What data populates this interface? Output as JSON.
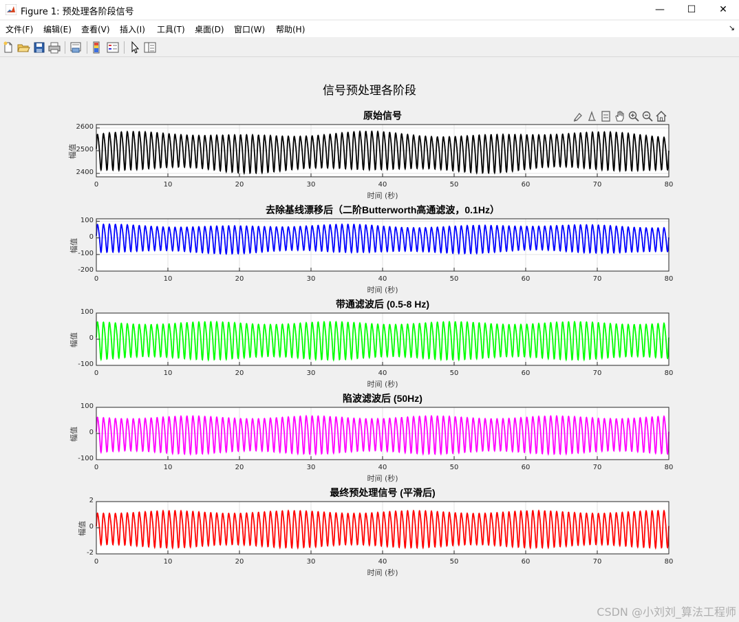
{
  "window": {
    "title": "Figure 1: 预处理各阶段信号",
    "minimize_glyph": "—",
    "maximize_glyph": "☐",
    "close_glyph": "✕"
  },
  "menu": [
    "文件(F)",
    "编辑(E)",
    "查看(V)",
    "插入(I)",
    "工具(T)",
    "桌面(D)",
    "窗口(W)",
    "帮助(H)"
  ],
  "menu_arrow": "↘",
  "toolbar_icons": [
    "new-figure-icon",
    "open-file-icon",
    "save-icon",
    "print-icon",
    "print-preview-icon",
    "colorbar-icon",
    "legend-icon",
    "cursor-icon",
    "property-editor-icon"
  ],
  "axes_toolbar_icons": [
    "brush-icon",
    "data-tips-icon",
    "restore-view-icon",
    "pan-icon",
    "zoom-in-icon",
    "zoom-out-icon",
    "home-icon"
  ],
  "figure_title": "信号预处理各阶段",
  "chart_data": [
    {
      "type": "line",
      "title": "原始信号",
      "xlabel": "时间 (秒)",
      "ylabel": "幅值",
      "xlim": [
        0,
        80
      ],
      "ylim": [
        2385,
        2615
      ],
      "xticks": [
        "0",
        "10",
        "20",
        "30",
        "40",
        "50",
        "60",
        "70",
        "80"
      ],
      "yticks": [
        "2400",
        "2500",
        "2600"
      ],
      "ytick_values": [
        2400,
        2500,
        2600
      ],
      "color": "#000000",
      "signal": {
        "baseline": 2500,
        "amplitude": 95,
        "beats": 96,
        "drift": 8
      },
      "grid": true
    },
    {
      "type": "line",
      "title": "去除基线漂移后（二阶Butterworth高通滤波，0.1Hz）",
      "xlabel": "时间 (秒)",
      "ylabel": "幅值",
      "xlim": [
        0,
        80
      ],
      "ylim": [
        -200,
        115
      ],
      "xticks": [
        "0",
        "10",
        "20",
        "30",
        "40",
        "50",
        "60",
        "70",
        "80"
      ],
      "yticks": [
        "100",
        "0",
        "-100",
        "-200"
      ],
      "ytick_values": [
        100,
        0,
        -100,
        -200
      ],
      "color": "#0000ff",
      "signal": {
        "baseline": 0,
        "amplitude": 95,
        "beats": 96,
        "drift": 5
      },
      "grid": true
    },
    {
      "type": "line",
      "title": "带通滤波后 (0.5-8 Hz)",
      "xlabel": "时间 (秒)",
      "ylabel": "幅值",
      "xlim": [
        0,
        80
      ],
      "ylim": [
        -100,
        100
      ],
      "xticks": [
        "0",
        "10",
        "20",
        "30",
        "40",
        "50",
        "60",
        "70",
        "80"
      ],
      "yticks": [
        "100",
        "0",
        "-100"
      ],
      "ytick_values": [
        100,
        0,
        -100
      ],
      "color": "#00ff00",
      "signal": {
        "baseline": 0,
        "amplitude": 82,
        "beats": 96,
        "drift": 0
      },
      "grid": true
    },
    {
      "type": "line",
      "title": "陷波滤波后 (50Hz)",
      "xlabel": "时间 (秒)",
      "ylabel": "幅值",
      "xlim": [
        0,
        80
      ],
      "ylim": [
        -100,
        100
      ],
      "xticks": [
        "0",
        "10",
        "20",
        "30",
        "40",
        "50",
        "60",
        "70",
        "80"
      ],
      "yticks": [
        "100",
        "0",
        "-100"
      ],
      "ytick_values": [
        100,
        0,
        -100
      ],
      "color": "#ff00ff",
      "signal": {
        "baseline": 0,
        "amplitude": 82,
        "beats": 96,
        "drift": 0
      },
      "grid": true
    },
    {
      "type": "line",
      "title": "最终预处理信号 (平滑后)",
      "xlabel": "时间 (秒)",
      "ylabel": "幅值",
      "xlim": [
        0,
        80
      ],
      "ylim": [
        -2,
        2
      ],
      "xticks": [
        "0",
        "10",
        "20",
        "30",
        "40",
        "50",
        "60",
        "70",
        "80"
      ],
      "yticks": [
        "2",
        "0",
        "-2"
      ],
      "ytick_values": [
        2,
        0,
        -2
      ],
      "color": "#ff0000",
      "signal": {
        "baseline": 0,
        "amplitude": 1.6,
        "beats": 96,
        "drift": 0
      },
      "grid": true
    }
  ],
  "watermark": "CSDN @小刘刘_算法工程师"
}
